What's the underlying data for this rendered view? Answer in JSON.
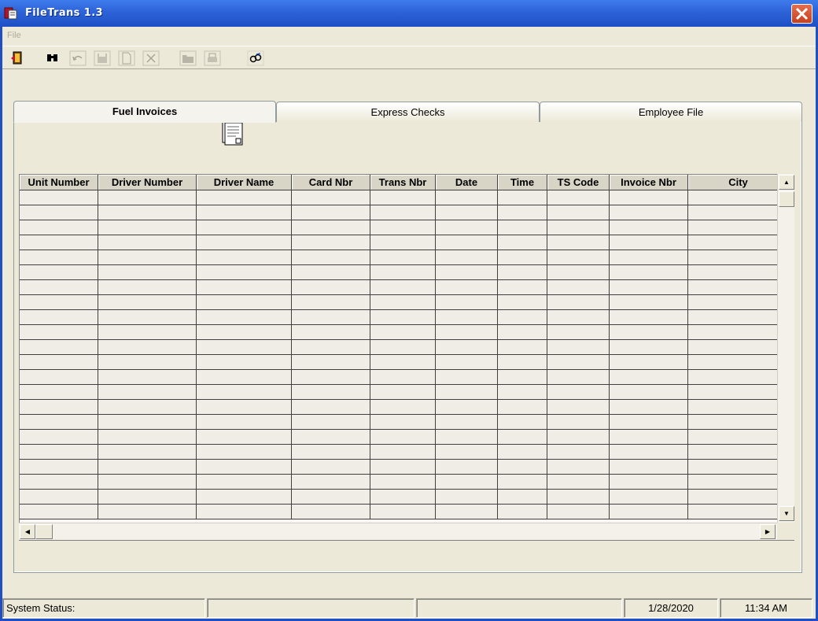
{
  "window": {
    "title": "FileTrans 1.3"
  },
  "menu": {
    "file_label": "File"
  },
  "toolbar": {
    "buttons": [
      {
        "icon": "exit-icon",
        "enabled": true
      },
      {
        "icon": "binoculars-icon",
        "enabled": true
      },
      {
        "icon": "undo-icon",
        "enabled": false
      },
      {
        "icon": "save-icon",
        "enabled": false
      },
      {
        "icon": "new-icon",
        "enabled": false
      },
      {
        "icon": "delete-icon",
        "enabled": false
      },
      {
        "icon": "folder-icon",
        "enabled": false
      },
      {
        "icon": "print-icon",
        "enabled": false
      },
      {
        "icon": "transfer-icon",
        "enabled": true
      }
    ]
  },
  "tabs": [
    {
      "label": "Fuel Invoices",
      "active": true
    },
    {
      "label": "Express Checks",
      "active": false
    },
    {
      "label": "Employee File",
      "active": false
    }
  ],
  "grid": {
    "columns": [
      "Unit Number",
      "Driver Number",
      "Driver Name",
      "Card Nbr",
      "Trans Nbr",
      "Date",
      "Time",
      "TS Code",
      "Invoice Nbr",
      "City"
    ]
  },
  "status": {
    "label": "System Status:",
    "panel2": "",
    "panel3": "",
    "date": "1/28/2020",
    "time": "11:34 AM"
  },
  "colors": {
    "titlebar": "#2D63D8",
    "close": "#D04A2A",
    "face": "#ECE9D8"
  }
}
